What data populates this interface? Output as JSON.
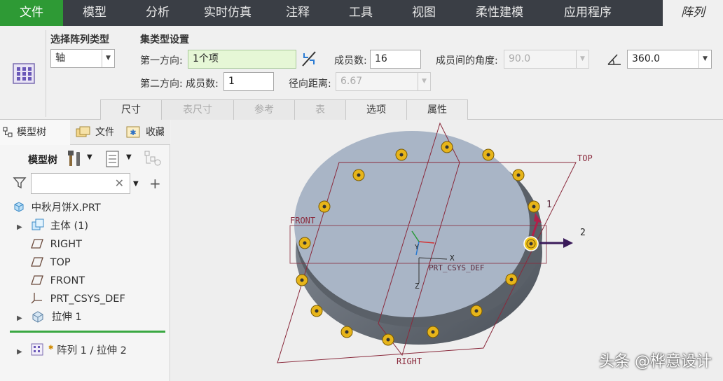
{
  "menubar": {
    "items": [
      "文件",
      "模型",
      "分析",
      "实时仿真",
      "注释",
      "工具",
      "视图",
      "柔性建模",
      "应用程序",
      "阵列"
    ]
  },
  "ribbon": {
    "pattern_type_label": "选择阵列类型",
    "pattern_type_value": "轴",
    "set_type_label": "集类型设置",
    "dir1_label": "第一方向:",
    "dir1_value": "1个项",
    "member_count_label": "成员数:",
    "member_count_value": "16",
    "member_angle_label": "成员间的角度:",
    "member_angle_value": "90.0",
    "total_angle_value": "360.0",
    "dir2_label": "第二方向: 成员数:",
    "dir2_count_value": "1",
    "radial_label": "径向距离:",
    "radial_value": "6.67",
    "tabs": [
      "尺寸",
      "表尺寸",
      "参考",
      "表",
      "选项",
      "属性"
    ]
  },
  "left_panel": {
    "tabs": [
      "模型树",
      "文件",
      "收藏"
    ],
    "toolbar_label": "模型树",
    "search_placeholder": "",
    "tree": [
      {
        "label": "中秋月饼X.PRT",
        "icon": "part-icon"
      },
      {
        "label": "主体 (1)",
        "icon": "body-icon",
        "expandable": true
      },
      {
        "label": "RIGHT",
        "icon": "plane-icon"
      },
      {
        "label": "TOP",
        "icon": "plane-icon"
      },
      {
        "label": "FRONT",
        "icon": "plane-icon"
      },
      {
        "label": "PRT_CSYS_DEF",
        "icon": "csys-icon"
      },
      {
        "label": "拉伸 1",
        "icon": "extrude-icon",
        "expandable": true
      }
    ],
    "pattern_item": "阵列 1 / 拉伸 2"
  },
  "viewport": {
    "plane_labels": {
      "top": "TOP",
      "front": "FRONT",
      "right": "RIGHT"
    },
    "csys_label": "PRT_CSYS_DEF",
    "axis_x": "X",
    "axis_y": "Y",
    "axis_z": "Z",
    "dir1_marker": "1",
    "dir2_marker": "2",
    "watermark": "头条 @桦意设计"
  },
  "colors": {
    "file_tab": "#2e9a35",
    "menubar": "#3a3e45",
    "disk_top": "#a9b5c6",
    "disk_side": "#5a6068",
    "pattern_dot": "#e7b51a",
    "datum_plane": "#8a2a3c"
  }
}
